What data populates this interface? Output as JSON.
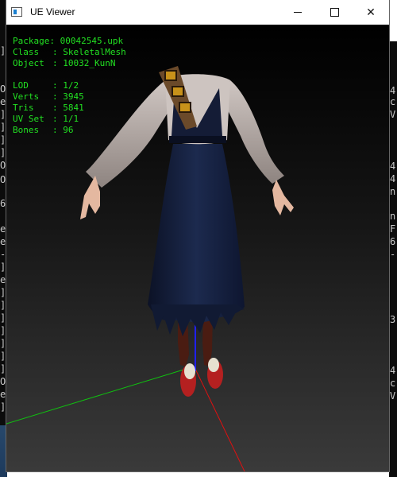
{
  "window": {
    "title": "UE Viewer",
    "controls": {
      "minimize": "—",
      "maximize": "☐",
      "close": "✕"
    }
  },
  "info": {
    "package_label": "Package",
    "package": "00042545.upk",
    "class_label": "Class",
    "class": "SkeletalMesh",
    "object_label": "Object",
    "object": "10032_KunN",
    "lod_label": "LOD",
    "lod": "1/2",
    "verts_label": "Verts",
    "verts": "3945",
    "tris_label": "Tris",
    "tris": "5841",
    "uvset_label": "UV Set",
    "uvset": "1/1",
    "bones_label": "Bones",
    "bones": "96"
  },
  "background_console": {
    "left_chars": [
      "]",
      "O",
      "e",
      "]",
      "]",
      "]",
      "]",
      "O",
      "O",
      "6",
      "e",
      "e",
      "-",
      "]",
      "e",
      "]",
      "]",
      "]",
      "]",
      "]",
      "]",
      "]",
      "O",
      "e",
      "]"
    ],
    "right_chars": [
      "4",
      "c",
      "V",
      "4",
      "4",
      "n",
      "n",
      "F",
      "6",
      "-",
      "3",
      "4",
      "c",
      "V"
    ]
  },
  "colors": {
    "overlay_text": "#22e022",
    "axis_x": "#e01010",
    "axis_y": "#10c010",
    "axis_z": "#2020ff"
  }
}
